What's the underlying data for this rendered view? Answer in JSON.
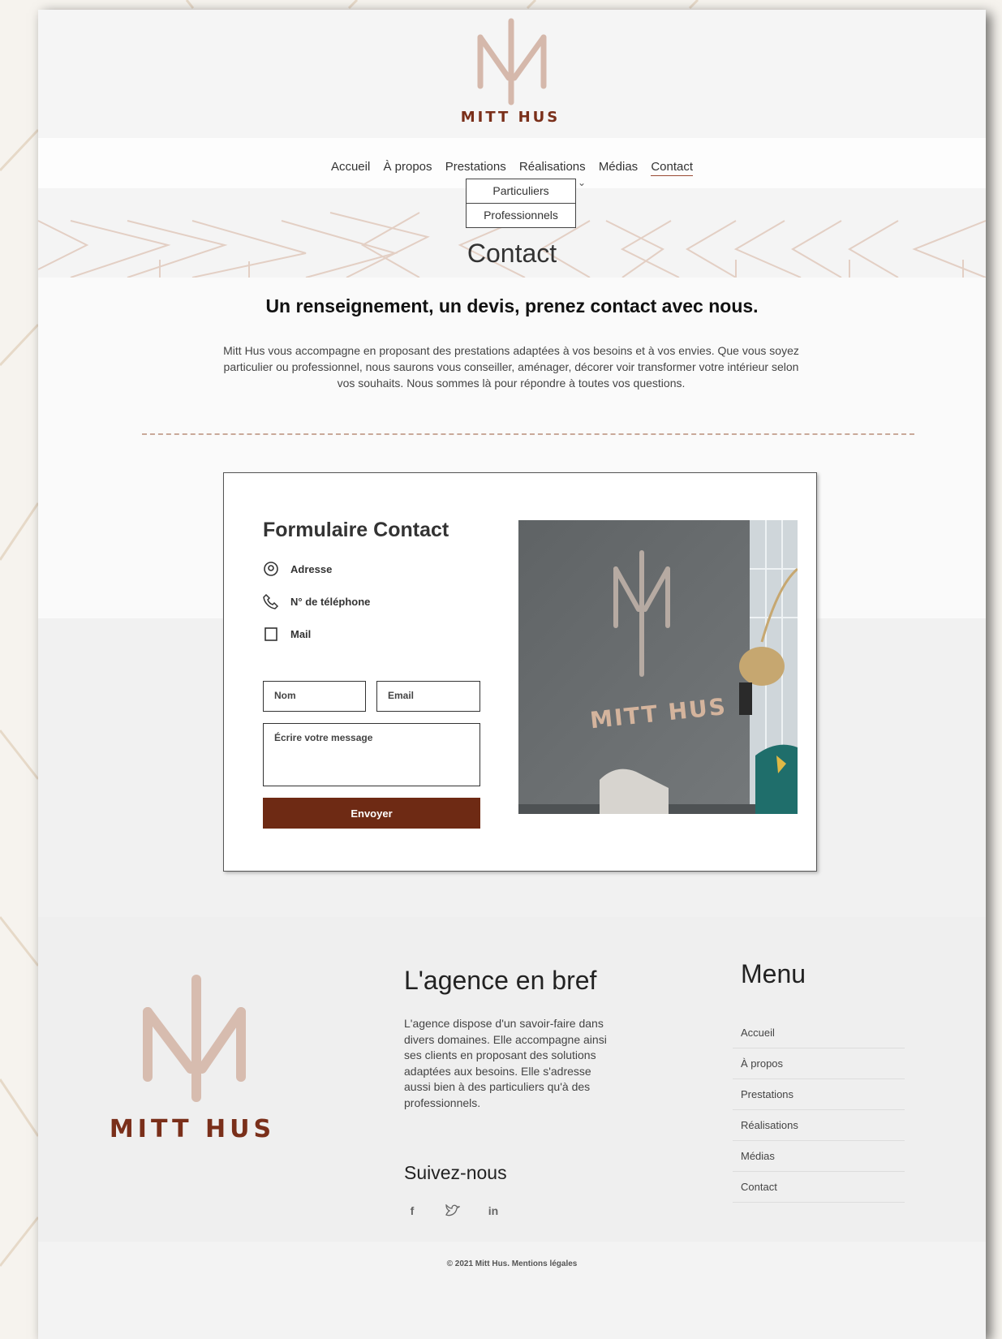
{
  "brand": {
    "logo_initials": "MH",
    "logo_name": "MITT HUS",
    "accent_color": "#6e2a14",
    "text_color": "#7a2f1a"
  },
  "nav": {
    "items": [
      "Accueil",
      "À propos",
      "Prestations",
      "Réalisations",
      "Médias",
      "Contact"
    ],
    "active": "Contact",
    "dropdown": [
      "Particuliers",
      "Professionnels"
    ]
  },
  "banner": {
    "title": "Contact"
  },
  "intro": {
    "headline": "Un renseignement, un devis, prenez contact avec nous.",
    "text": "Mitt Hus vous accompagne en  proposant des prestations adaptées à vos  besoins et à vos envies. Que vous soyez particulier ou professionnel, nous saurons vous conseiller, aménager, décorer voir transformer votre intérieur selon vos souhaits. Nous sommes là pour répondre à toutes vos questions."
  },
  "contact_form": {
    "title": "Formulaire Contact",
    "address_label": "Adresse",
    "phone_label": "N° de téléphone",
    "mail_label": "Mail",
    "name_placeholder": "Nom",
    "email_placeholder": "Email",
    "message_placeholder": "Écrire votre message",
    "submit_label": "Envoyer"
  },
  "footer": {
    "about_title": "L'agence en bref",
    "about_text": "L'agence dispose d'un savoir-faire dans divers domaines. Elle accompagne ainsi ses clients en proposant des solutions adaptées aux besoins. Elle s'adresse aussi bien à des particuliers qu'à des professionnels.",
    "follow_title": "Suivez-nous",
    "socials": [
      "facebook-icon",
      "twitter-icon",
      "linkedin-icon"
    ],
    "menu_title": "Menu",
    "menu_items": [
      "Accueil",
      "À propos",
      "Prestations",
      "Réalisations",
      "Médias",
      "Contact"
    ],
    "copyright": "© 2021 Mitt Hus.  Mentions légales"
  }
}
